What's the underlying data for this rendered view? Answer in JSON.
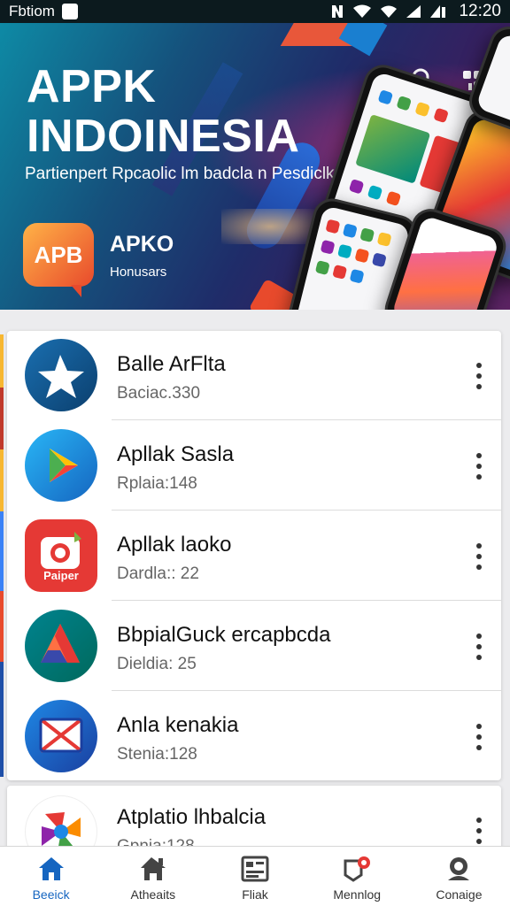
{
  "status_bar": {
    "left_text": "Fbtiom",
    "time": "12:20",
    "icons": [
      "notification-icon",
      "nfc-icon",
      "wifi-icon",
      "signal-icon",
      "battery-icon"
    ]
  },
  "banner": {
    "title_line1": "APPK",
    "title_line2": "INDOINESIA",
    "subtitle": "Partienpert Rpcaolic lm badcla n Pesdiclk1",
    "logo_text": "APB",
    "brand_name": "APKO",
    "brand_sub": "Honusars",
    "accent_colors": [
      "#0e8aa5",
      "#1f2c69",
      "#5d2463",
      "#e84a2c"
    ]
  },
  "apps": [
    {
      "name": "Balle ArFlta",
      "meta": "Baciac.330",
      "icon": "star-app-icon"
    },
    {
      "name": "Apllak Sasla",
      "meta": "Rplaia:148",
      "icon": "play-store-icon"
    },
    {
      "name": "Apllak laoko",
      "meta": "Dardla:: 22",
      "icon": "camera-app-icon",
      "icon_label": "Paiper"
    },
    {
      "name": "BbpialGuck ercapbcda",
      "meta": "Dieldia: 25",
      "icon": "drive-triangle-icon"
    },
    {
      "name": "Anla kenakia",
      "meta": "Stenia:128",
      "icon": "mail-app-icon"
    },
    {
      "name": "Atplatio lhbalcia",
      "meta": "Gpnia:128",
      "icon": "pinwheel-app-icon"
    }
  ],
  "bottom_nav": [
    {
      "label": "Beeick",
      "icon": "home-icon",
      "active": true
    },
    {
      "label": "Atheaits",
      "icon": "store-icon",
      "active": false
    },
    {
      "label": "Fliak",
      "icon": "grid-list-icon",
      "active": false
    },
    {
      "label": "Mennlog",
      "icon": "notification-badge-icon",
      "active": false
    },
    {
      "label": "Conaige",
      "icon": "profile-icon",
      "active": false
    }
  ],
  "colors": {
    "active_nav": "#1565c0",
    "text_primary": "#111111",
    "text_secondary": "#666666"
  }
}
